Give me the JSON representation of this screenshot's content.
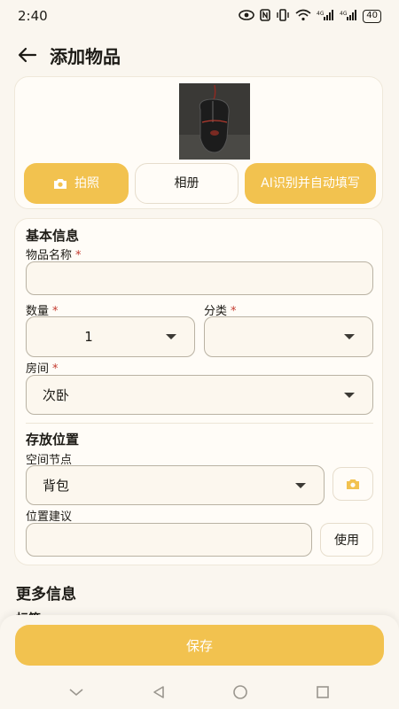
{
  "status_bar": {
    "time": "2:40",
    "battery": "40",
    "signal_label_1": "4G",
    "signal_label_2": "4G"
  },
  "header": {
    "title": "添加物品"
  },
  "photo_section": {
    "camera_button": "拍照",
    "album_button": "相册",
    "ai_button": "AI识别并自动填写"
  },
  "basic_info": {
    "section_title": "基本信息",
    "name_label": "物品名称",
    "name_value": "",
    "quantity_label": "数量",
    "quantity_value": "1",
    "category_label": "分类",
    "category_value": "",
    "room_label": "房间",
    "room_value": "次卧",
    "required_mark": "*"
  },
  "storage": {
    "section_title": "存放位置",
    "node_label": "空间节点",
    "node_value": "背包",
    "suggestion_label": "位置建议",
    "suggestion_value": "",
    "use_button": "使用"
  },
  "more_info": {
    "section_title": "更多信息",
    "tags_label": "标签"
  },
  "footer": {
    "save_button": "保存"
  },
  "colors": {
    "accent": "#f2c24f",
    "background": "#faf6ef",
    "required": "#c43b2f"
  }
}
